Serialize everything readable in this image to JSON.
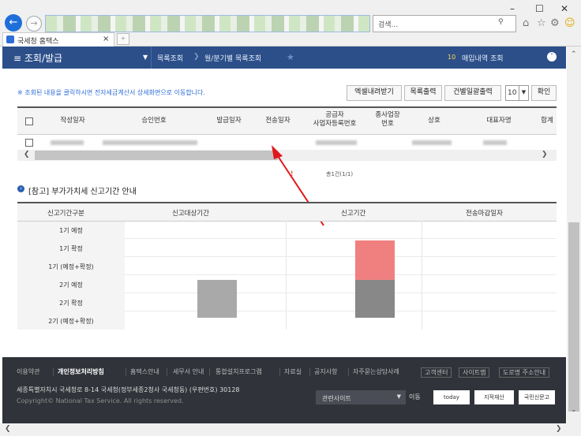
{
  "browser": {
    "search_placeholder": "검색...",
    "tab_title": "국세청 홈택스",
    "tab_close": "×",
    "win_min": "–",
    "win_max": "☐",
    "win_close": "✕"
  },
  "nav": {
    "menu_label": "조회/발급",
    "crumb_1": "목록조회",
    "crumb_2": "월/분기별 목록조회",
    "flag": "10",
    "side_link": "매입내역 조회"
  },
  "toolbar": {
    "hint": "※ 조회된 내용을 클릭하시면 전자세금계산서 상세화면으로 이동합니다.",
    "excel": "엑셀내려받기",
    "print_list": "목록출력",
    "print_each": "건별일괄출력",
    "page_size": "10",
    "confirm": "확인"
  },
  "table": {
    "headers": [
      "작성일자",
      "승인번호",
      "발급일자",
      "전송일자",
      "공급자\n사업자등록번호",
      "종사업장\n번호",
      "상호",
      "대표자명",
      "합계"
    ],
    "count_text": "총1건(1/1)"
  },
  "notice": {
    "title": "[참고] 부가가치세 신고기간 안내",
    "headers": [
      "신고기간구분",
      "신고대상기간",
      "신고기간",
      "전송마감일자"
    ],
    "rows": [
      "1기 예정",
      "1기 확정",
      "1기 (예정+확정)",
      "2기 예정",
      "2기 확정",
      "2기 (예정+확정)"
    ]
  },
  "footer": {
    "links": [
      "이용약관",
      "개인정보처리방침",
      "홈택스안내",
      "세무서 안내",
      "통합설치프로그램",
      "자료실",
      "공지사항",
      "자주묻는상담사례",
      "고객센터",
      "사이트맵",
      "도로명 주소안내"
    ],
    "address": "세종특별자치시 국세청로 8-14 국세청(정부세종2청사 국세청동) (우편번호) 30128",
    "copyright": "Copyright© National Tax Service. All rights reserved.",
    "related_sites": "관련사이트",
    "go": "이동",
    "banner_1": "today",
    "banner_2": "지적재산",
    "banner_3": "국민신문고"
  },
  "colors": {
    "nav": "#2c4f8a",
    "accent_blue": "#2e6ed6",
    "annotation_red": "#e0181c",
    "bar_pink": "#f08080",
    "bar_gray": "#888888"
  }
}
